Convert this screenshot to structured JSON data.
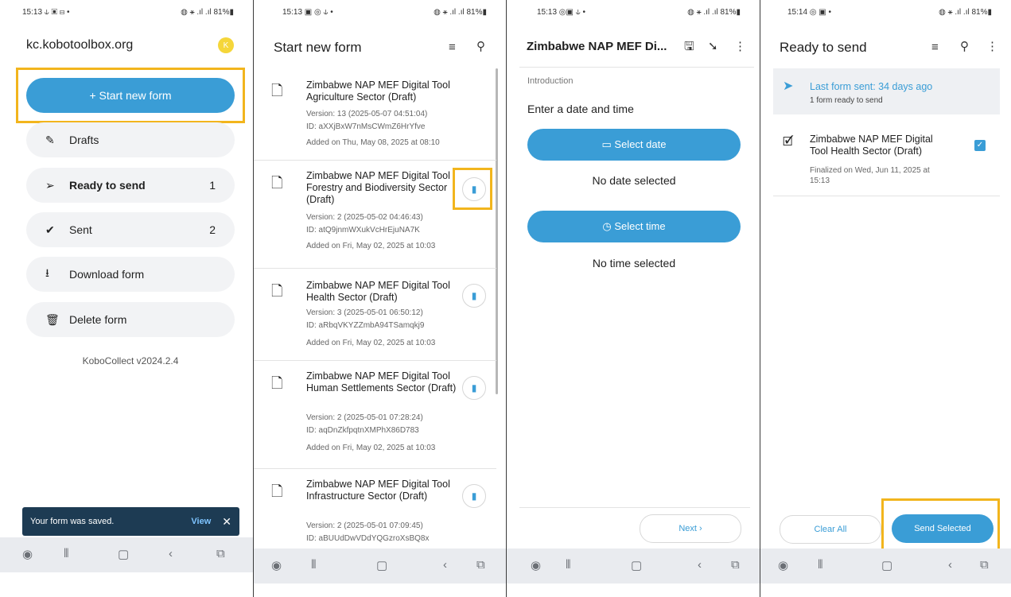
{
  "panel1": {
    "status": {
      "time": "15:13 ⫝ ▣ ⊟ •",
      "right": "◍ ⚹ .ıl .ıl 81%▮"
    },
    "title": "kc.kobotoolbox.org",
    "avatar": "K",
    "start_label": "+   Start new form",
    "menu": [
      {
        "icon": "✎",
        "label": "Drafts",
        "count": ""
      },
      {
        "icon": "➢",
        "label": "Ready to send",
        "count": "1"
      },
      {
        "icon": "✔",
        "label": "Sent",
        "count": "2"
      },
      {
        "icon": "⭳",
        "label": "Download form",
        "count": ""
      },
      {
        "icon": "🗑",
        "label": "Delete form",
        "count": ""
      }
    ],
    "version": "KoboCollect v2024.2.4",
    "snackbar": {
      "message": "Your form was saved.",
      "action": "View",
      "close": "✕"
    }
  },
  "panel2": {
    "status": {
      "time": "15:13 ▣ ◎ ⫝ •",
      "right": "◍ ⚹ .ıl .ıl 81%▮"
    },
    "title": "Start new form",
    "forms": [
      {
        "title": "Zimbabwe NAP MEF Digital Tool Agriculture Sector (Draft)",
        "version": "Version: 13 (2025-05-07 04:51:04)",
        "id": "ID: aXXjBxW7nMsCWmZ6HrYfve",
        "added": "Added on Thu, May 08, 2025 at 08:10"
      },
      {
        "title": "Zimbabwe NAP MEF Digital Tool Forestry and Biodiversity Sector (Draft)",
        "version": "Version: 2 (2025-05-02 04:46:43)",
        "id": "ID: atQ9jnmWXukVcHrEjuNA7K",
        "added": "Added on Fri, May 02, 2025 at 10:03"
      },
      {
        "title": "Zimbabwe NAP MEF Digital Tool Health Sector (Draft)",
        "version": "Version: 3 (2025-05-01 06:50:12)",
        "id": "ID: aRbqVKYZZmbA94TSamqkj9",
        "added": "Added on Fri, May 02, 2025 at 10:03"
      },
      {
        "title": "Zimbabwe NAP MEF Digital Tool Human Settlements Sector (Draft)",
        "version": "Version: 2 (2025-05-01 07:28:24)",
        "id": "ID: aqDnZkfpqtnXMPhX86D783",
        "added": "Added on Fri, May 02, 2025 at 10:03"
      },
      {
        "title": "Zimbabwe NAP MEF Digital Tool Infrastructure Sector (Draft)",
        "version": "Version: 2 (2025-05-01 07:09:45)",
        "id": "ID: aBUUdDwVDdYQGzroXsBQ8x",
        "added": ""
      }
    ]
  },
  "panel3": {
    "status": {
      "time": "15:13 ◎▣ ⫝ •",
      "right": "◍ ⚹ .ıl .ıl 81%▮"
    },
    "title": "Zimbabwe NAP MEF Di...",
    "section": "Introduction",
    "question": "Enter a date and time",
    "date_button": "▭  Select date",
    "no_date": "No date selected",
    "time_button": "◷  Select time",
    "no_time": "No time selected",
    "next": "Next  ›"
  },
  "panel4": {
    "status": {
      "time": "15:14 ◎ ▣   •",
      "right": "◍ ⚹ .ıl .ıl 81%▮"
    },
    "title": "Ready to send",
    "banner_title": "Last form sent: 34 days ago",
    "banner_sub": "1 form ready to send",
    "item_title": "Zimbabwe NAP MEF Digital Tool Health Sector (Draft)",
    "item_meta": "Finalized on Wed, Jun 11, 2025 at 15:13",
    "clear_all": "Clear All",
    "send_selected": "Send Selected"
  },
  "colors": {
    "accent": "#3a9dd6",
    "highlight": "#f2b51d",
    "snackbar": "#1d3b53"
  }
}
